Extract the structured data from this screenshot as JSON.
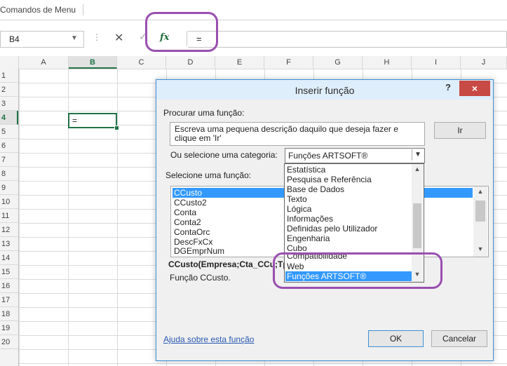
{
  "ribbon": {
    "label": "Comandos de Menu"
  },
  "formula_bar": {
    "name_box": "B4",
    "formula": "=",
    "fx": "fx"
  },
  "grid": {
    "columns": [
      "A",
      "B",
      "C",
      "D",
      "E",
      "F",
      "G",
      "H",
      "I",
      "J"
    ],
    "rows": [
      "1",
      "2",
      "3",
      "4",
      "5",
      "6",
      "7",
      "8",
      "9",
      "10",
      "11",
      "12",
      "13",
      "14",
      "15",
      "16",
      "17",
      "18",
      "19",
      "20"
    ],
    "active_cell_value": "="
  },
  "dialog": {
    "title": "Inserir função",
    "help": "?",
    "close": "×",
    "search_label": "Procurar uma função:",
    "search_text": "Escreva uma pequena descrição daquilo que deseja fazer e clique em 'Ir'",
    "go_button": "Ir",
    "category_label": "Ou selecione uma categoria:",
    "category_value": "Funções ARTSOFT®",
    "function_label": "Selecione uma função:",
    "functions": [
      "CCusto",
      "CCusto2",
      "Conta",
      "Conta2",
      "ContaOrc",
      "DescFxCx",
      "DGEmprNum"
    ],
    "signature": "CCusto(Empresa;Cta_CCu;Tp;",
    "description": "Função CCusto.",
    "help_link": "Ajuda sobre esta função",
    "ok_button": "OK",
    "cancel_button": "Cancelar"
  },
  "category_dropdown": {
    "options": [
      "Estatística",
      "Pesquisa e Referência",
      "Base de Dados",
      "Texto",
      "Lógica",
      "Informações",
      "Definidas pelo Utilizador",
      "Engenharia",
      "Cubo",
      "Compatibilidade",
      "Web",
      "Funções ARTSOFT®"
    ],
    "selected": "Funções ARTSOFT®"
  },
  "colors": {
    "accent_green": "#217346",
    "highlight_purple": "#9a4fb0",
    "selection_blue": "#3399ff",
    "close_red": "#c74a44"
  }
}
